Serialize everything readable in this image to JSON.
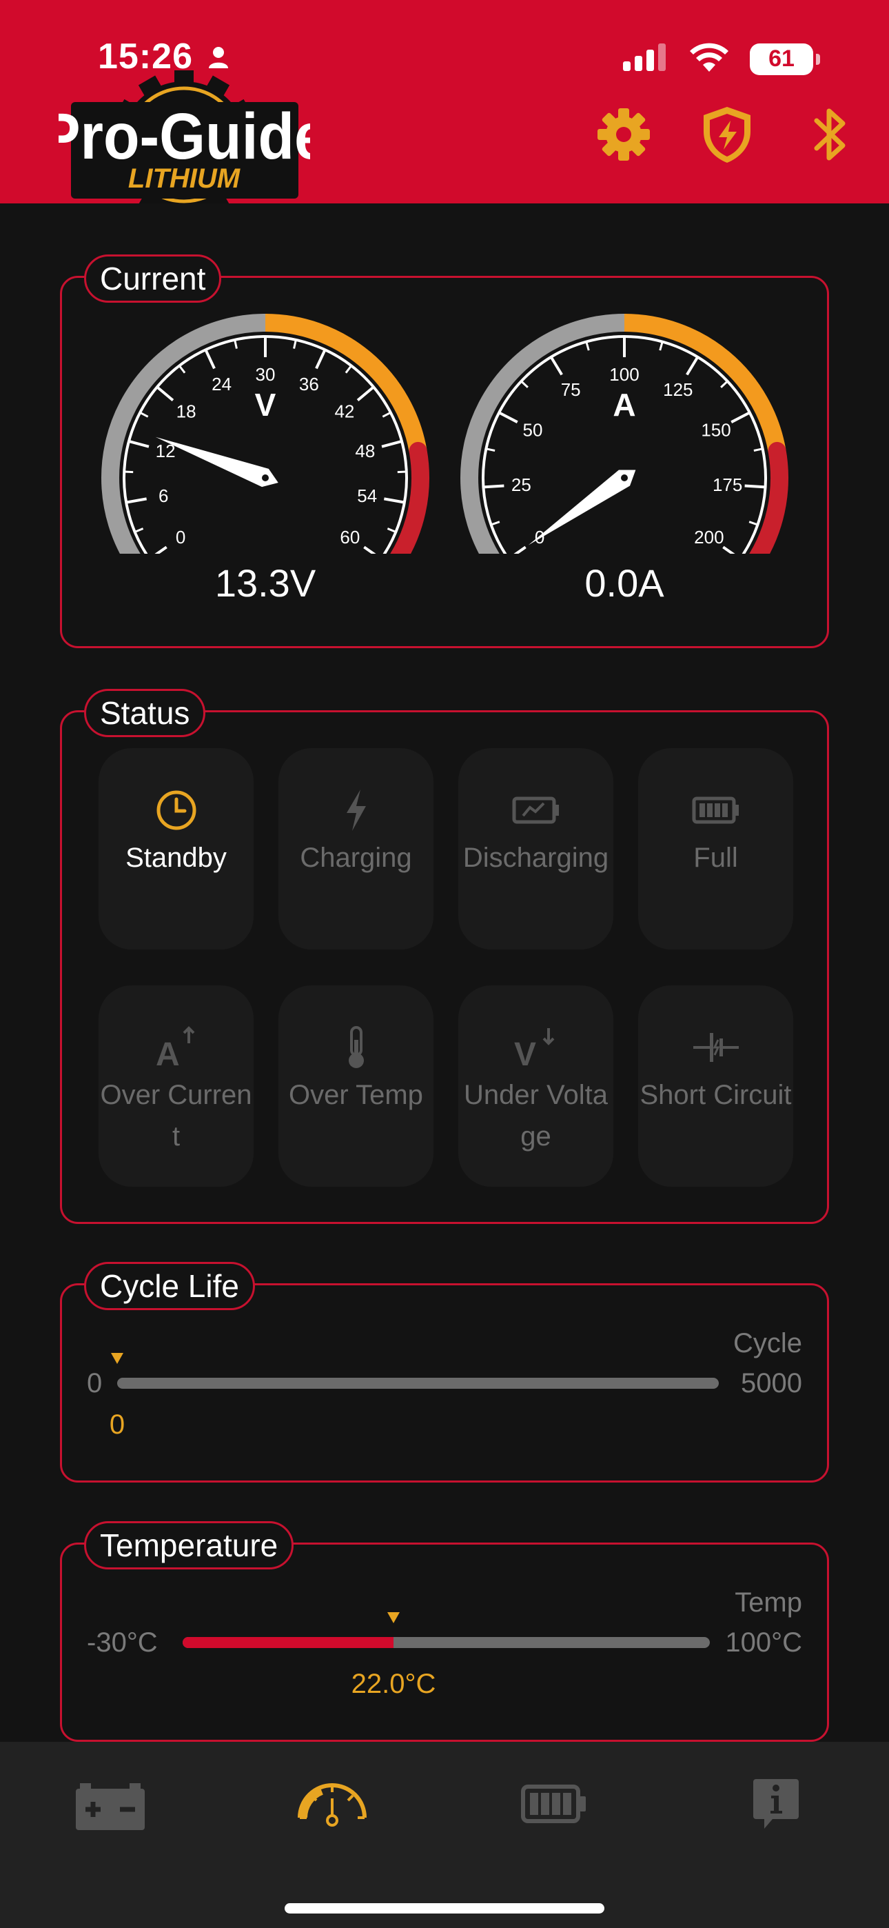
{
  "statusbar": {
    "time": "15:26",
    "battery": "61"
  },
  "brand": {
    "name": "Pro-Guide",
    "sub": "LITHIUM"
  },
  "colors": {
    "header_red": "#d10a2c",
    "accent_gold": "#e8a522",
    "gauge_gray": "#9e9e9e",
    "gauge_orange": "#f39a1e",
    "gauge_red": "#c9202c"
  },
  "header_icons": [
    "gear-icon",
    "shield-bolt-icon",
    "bluetooth-icon"
  ],
  "current": {
    "title": "Current",
    "voltage": {
      "unit": "V",
      "ticks": [
        "0",
        "6",
        "12",
        "18",
        "24",
        "30",
        "36",
        "42",
        "48",
        "54",
        "60"
      ],
      "min": 0,
      "max": 60,
      "value": 13.3,
      "display": "13.3V"
    },
    "amperage": {
      "unit": "A",
      "ticks": [
        "0",
        "25",
        "50",
        "75",
        "100",
        "125",
        "150",
        "175",
        "200"
      ],
      "min": 0,
      "max": 200,
      "value": 0.0,
      "display": "0.0A"
    }
  },
  "status": {
    "title": "Status",
    "tiles": [
      {
        "label": "Standby",
        "icon": "clock-icon",
        "active": true
      },
      {
        "label": "Charging",
        "icon": "bolt-icon",
        "active": false
      },
      {
        "label": "Discharging",
        "icon": "battery-discharge-icon",
        "active": false
      },
      {
        "label": "Full",
        "icon": "battery-full-icon",
        "active": false
      },
      {
        "label": "Over Current",
        "icon": "amp-up-icon",
        "active": false
      },
      {
        "label": "Over Temp",
        "icon": "thermometer-icon",
        "active": false
      },
      {
        "label": "Under Voltage",
        "icon": "volt-down-icon",
        "active": false
      },
      {
        "label": "Short Circuit",
        "icon": "short-circuit-icon",
        "active": false
      }
    ]
  },
  "cycle_life": {
    "title": "Cycle Life",
    "unit_label": "Cycle",
    "min_label": "0",
    "max_label": "5000",
    "min": 0,
    "max": 5000,
    "value": 0,
    "value_label": "0"
  },
  "temperature": {
    "title": "Temperature",
    "unit_label": "Temp",
    "min_label": "-30°C",
    "max_label": "100°C",
    "min": -30,
    "max": 100,
    "value": 22.0,
    "value_label": "22.0°C"
  },
  "bottom_nav": [
    "battery-terminals-icon",
    "gauge-icon",
    "battery-icon",
    "info-icon"
  ]
}
